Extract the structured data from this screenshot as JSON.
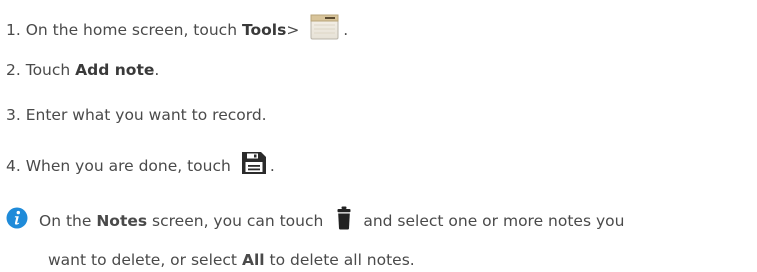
{
  "steps": [
    {
      "num": "1.",
      "pre": "On the home screen, touch",
      "bold": "Tools",
      "post": " >",
      "icon": "notes-app-icon",
      "tail": "."
    },
    {
      "num": "2.",
      "pre": "Touch",
      "bold": "Add note",
      "tail": "."
    },
    {
      "num": "3.",
      "text": "Enter what you want to record."
    },
    {
      "num": "4.",
      "pre": "When you are done, touch",
      "icon": "save-icon",
      "tail": "."
    }
  ],
  "note": {
    "icon": "info-icon",
    "line1_a": "On the",
    "line1_bold": "Notes",
    "line1_b": "screen, you can touch",
    "line1_icon": "trash-icon",
    "line1_c": "and select one or more notes you",
    "line2_a": "want to delete, or select",
    "line2_bold": "All",
    "line2_b": "to delete all notes."
  },
  "colors": {
    "text": "#4a4a4a",
    "info_icon": "#1f8bd9"
  }
}
